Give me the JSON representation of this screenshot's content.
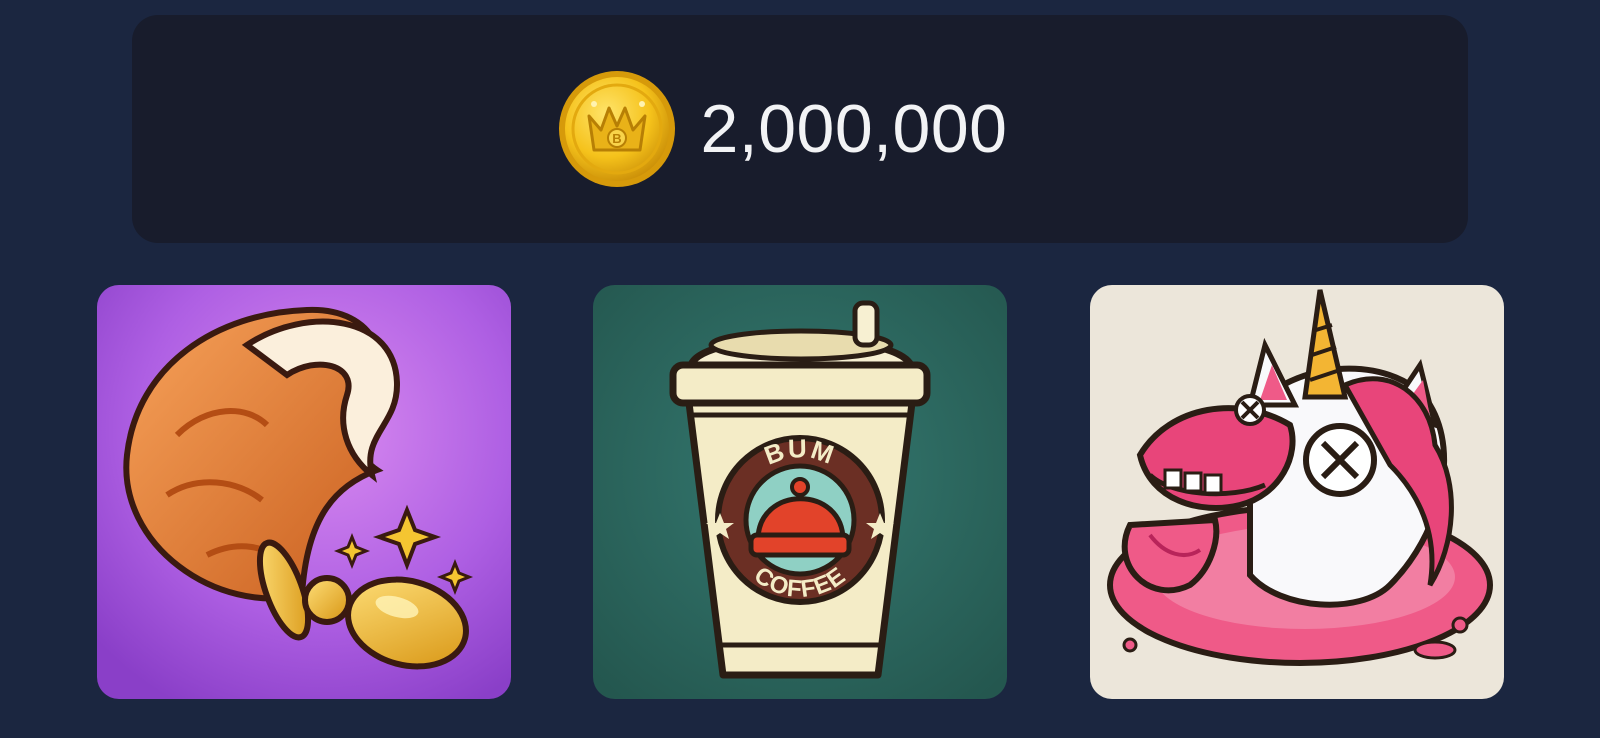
{
  "balance": {
    "amount": "2,000,000",
    "currency_icon": "gold-crown-coin-icon",
    "coin_color": "#f5c21b",
    "coin_mark": "B"
  },
  "cards": [
    {
      "icon": "fox-tail-plug-icon",
      "background": "#a54fdc"
    },
    {
      "icon": "bum-coffee-cup-icon",
      "background": "#2d6b64",
      "cup_logo_top": "BUM",
      "cup_logo_bottom": "COFFEE"
    },
    {
      "icon": "melting-unicorn-icon",
      "background": "#ece6da"
    }
  ],
  "colors": {
    "page_background": "#1b2640",
    "panel_background": "#181c2c",
    "balance_text": "#f2f3f5"
  }
}
